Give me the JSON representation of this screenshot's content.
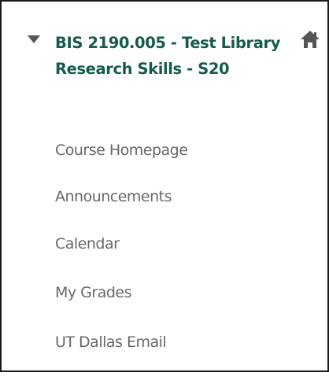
{
  "colors": {
    "course_title": "#165b4b",
    "nav_text": "#686868",
    "icon": "#555555",
    "border": "#1a1a1a"
  },
  "course": {
    "title": "BIS 2190.005 - Test Library Research Skills - S20",
    "toggle_icon": "caret-down-icon",
    "home_icon": "home-icon"
  },
  "nav": {
    "items": [
      {
        "label": "Course Homepage"
      },
      {
        "label": "Announcements"
      },
      {
        "label": "Calendar"
      },
      {
        "label": "My Grades"
      },
      {
        "label": "UT Dallas Email"
      }
    ]
  }
}
